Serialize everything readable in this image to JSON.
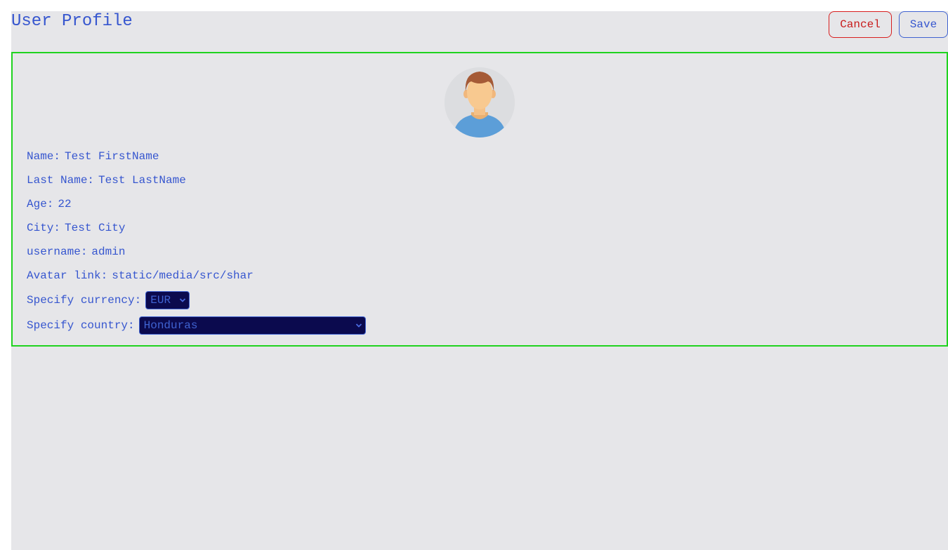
{
  "header": {
    "title": "User Profile",
    "cancel_label": "Cancel",
    "save_label": "Save"
  },
  "profile": {
    "fields": [
      {
        "label": "Name:",
        "value": "Test FirstName"
      },
      {
        "label": "Last Name:",
        "value": "Test LastName"
      },
      {
        "label": "Age:",
        "value": "22"
      },
      {
        "label": "City:",
        "value": "Test City"
      },
      {
        "label": "username:",
        "value": "admin"
      },
      {
        "label": "Avatar link:",
        "value": "static/media/src/shar"
      }
    ],
    "currency": {
      "label": "Specify currency:",
      "selected": "EUR"
    },
    "country": {
      "label": "Specify country:",
      "selected": "Honduras"
    }
  },
  "colors": {
    "accent": "#3656cf",
    "cancel": "#d81e1e",
    "card_border": "#1fd31f",
    "select_bg": "#0b0a4e",
    "page_bg": "#e6e6e9"
  },
  "icons": {
    "avatar": "user-avatar-icon",
    "select_arrow": "chevron-down-icon"
  }
}
